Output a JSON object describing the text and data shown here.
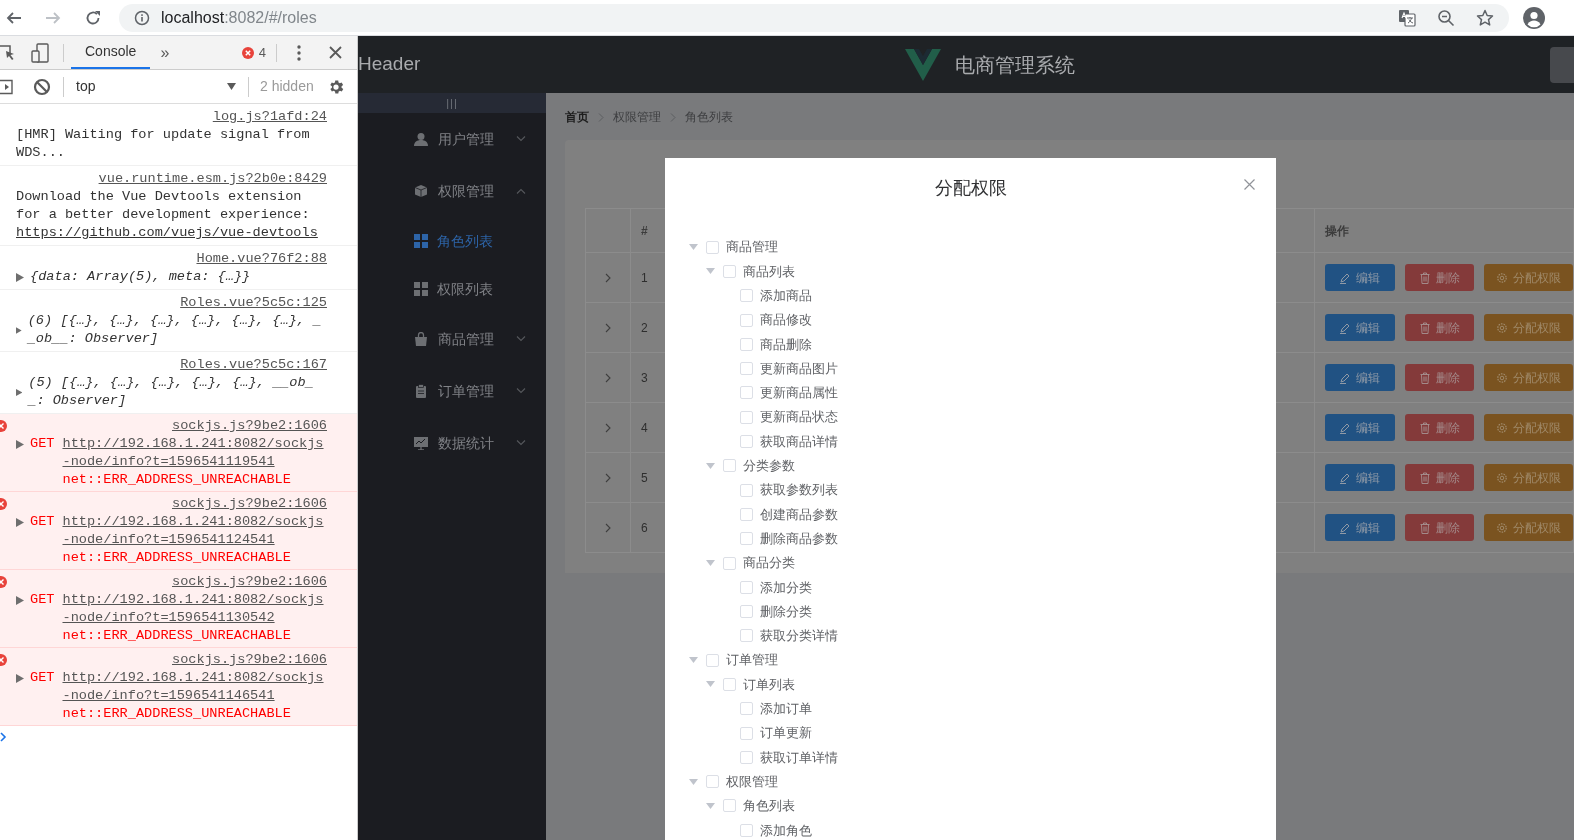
{
  "browser": {
    "url_host": "localhost",
    "url_rest": ":8082/#/roles"
  },
  "devtools": {
    "tabs": [
      {
        "label": "Console",
        "selected": true
      }
    ],
    "overflow": "»",
    "error_count": "4",
    "context": "top",
    "hidden": "2 hidden",
    "messages": [
      {
        "kind": "log",
        "text": "[HMR] Waiting for update signal from WDS...",
        "source": "log.js?1afd:24"
      },
      {
        "kind": "log",
        "text": "Download the Vue Devtools extension for a better development experience:",
        "link": "https://github.com/vuejs/vue-devtools",
        "source": "vue.runtime.esm.js?2b0e:8429"
      },
      {
        "kind": "object",
        "text": "{data: Array(5), meta: {…}}",
        "source": "Home.vue?76f2:88"
      },
      {
        "kind": "object",
        "text": "(6) [{…}, {…}, {…}, {…}, {…}, {…}, __ob__: Observer]",
        "source": "Roles.vue?5c5c:125"
      },
      {
        "kind": "object",
        "text": "(5) [{…}, {…}, {…}, {…}, {…}, __ob__: Observer]",
        "source": "Roles.vue?5c5c:167"
      },
      {
        "kind": "error",
        "method": "GET",
        "url": "http://192.168.1.241:8082/sockjs-node/info?t=1596541119541",
        "error": "net::ERR_ADDRESS_UNREACHABLE",
        "source": "sockjs.js?9be2:1606"
      },
      {
        "kind": "error",
        "method": "GET",
        "url": "http://192.168.1.241:8082/sockjs-node/info?t=1596541124541",
        "error": "net::ERR_ADDRESS_UNREACHABLE",
        "source": "sockjs.js?9be2:1606"
      },
      {
        "kind": "error",
        "method": "GET",
        "url": "http://192.168.1.241:8082/sockjs-node/info?t=1596541130542",
        "error": "net::ERR_ADDRESS_UNREACHABLE",
        "source": "sockjs.js?9be2:1606"
      },
      {
        "kind": "error",
        "method": "GET",
        "url": "http://192.168.1.241:8082/sockjs-node/info?t=1596541146541",
        "error": "net::ERR_ADDRESS_UNREACHABLE",
        "source": "sockjs.js?9be2:1606"
      }
    ]
  },
  "app": {
    "header": {
      "brand": "Header",
      "title": "电商管理系统"
    },
    "sidebar": {
      "toggle": "|||",
      "items": [
        {
          "label": "用户管理",
          "expanded": false
        },
        {
          "label": "权限管理",
          "expanded": true,
          "children": [
            {
              "label": "角色列表",
              "selected": true
            },
            {
              "label": "权限列表",
              "selected": false
            }
          ]
        },
        {
          "label": "商品管理",
          "expanded": false
        },
        {
          "label": "订单管理",
          "expanded": false
        },
        {
          "label": "数据统计",
          "expanded": false
        }
      ]
    },
    "breadcrumb": [
      "首页",
      "权限管理",
      "角色列表"
    ],
    "table": {
      "columns": [
        "#",
        "操作"
      ],
      "rows": [
        {
          "index": "1",
          "expanded": false,
          "actions": [
            {
              "kind": "edit",
              "label": "编辑"
            },
            {
              "kind": "delete",
              "label": "删除"
            },
            {
              "kind": "assign",
              "label": "分配权限"
            }
          ]
        },
        {
          "index": "2",
          "expanded": false,
          "actions": [
            {
              "kind": "edit",
              "label": "编辑"
            },
            {
              "kind": "delete",
              "label": "删除"
            },
            {
              "kind": "assign",
              "label": "分配权限"
            }
          ]
        },
        {
          "index": "3",
          "expanded": false,
          "actions": [
            {
              "kind": "edit",
              "label": "编辑"
            },
            {
              "kind": "delete",
              "label": "删除"
            },
            {
              "kind": "assign",
              "label": "分配权限"
            }
          ]
        },
        {
          "index": "4",
          "expanded": false,
          "actions": [
            {
              "kind": "edit",
              "label": "编辑"
            },
            {
              "kind": "delete",
              "label": "删除"
            },
            {
              "kind": "assign",
              "label": "分配权限"
            }
          ]
        },
        {
          "index": "5",
          "expanded": false,
          "actions": [
            {
              "kind": "edit",
              "label": "编辑"
            },
            {
              "kind": "delete",
              "label": "删除"
            },
            {
              "kind": "assign",
              "label": "分配权限"
            }
          ]
        },
        {
          "index": "6",
          "expanded": false,
          "actions": [
            {
              "kind": "edit",
              "label": "编辑"
            },
            {
              "kind": "delete",
              "label": "删除"
            },
            {
              "kind": "assign",
              "label": "分配权限"
            }
          ]
        }
      ]
    }
  },
  "dialog": {
    "title": "分配权限",
    "tree": [
      {
        "label": "商品管理",
        "checked": false,
        "expanded": true,
        "children": [
          {
            "label": "商品列表",
            "checked": false,
            "expanded": true,
            "children": [
              {
                "label": "添加商品",
                "checked": false
              },
              {
                "label": "商品修改",
                "checked": false
              },
              {
                "label": "商品删除",
                "checked": false
              },
              {
                "label": "更新商品图片",
                "checked": false
              },
              {
                "label": "更新商品属性",
                "checked": false
              },
              {
                "label": "更新商品状态",
                "checked": false
              },
              {
                "label": "获取商品详情",
                "checked": false
              }
            ]
          },
          {
            "label": "分类参数",
            "checked": false,
            "expanded": true,
            "children": [
              {
                "label": "获取参数列表",
                "checked": false
              },
              {
                "label": "创建商品参数",
                "checked": false
              },
              {
                "label": "删除商品参数",
                "checked": false
              }
            ]
          },
          {
            "label": "商品分类",
            "checked": false,
            "expanded": true,
            "children": [
              {
                "label": "添加分类",
                "checked": false
              },
              {
                "label": "删除分类",
                "checked": false
              },
              {
                "label": "获取分类详情",
                "checked": false
              }
            ]
          }
        ]
      },
      {
        "label": "订单管理",
        "checked": false,
        "expanded": true,
        "children": [
          {
            "label": "订单列表",
            "checked": false,
            "expanded": true,
            "children": [
              {
                "label": "添加订单",
                "checked": false
              },
              {
                "label": "订单更新",
                "checked": false
              },
              {
                "label": "获取订单详情",
                "checked": false
              }
            ]
          }
        ]
      },
      {
        "label": "权限管理",
        "checked": false,
        "expanded": true,
        "children": [
          {
            "label": "角色列表",
            "checked": false,
            "expanded": true,
            "children": [
              {
                "label": "添加角色",
                "checked": false
              }
            ]
          }
        ]
      }
    ]
  }
}
